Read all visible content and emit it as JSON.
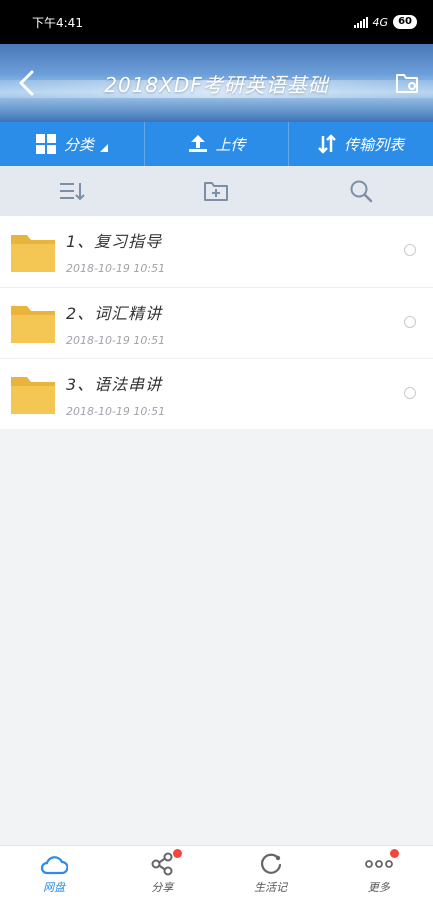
{
  "status_bar": {
    "time": "下午4:41",
    "network": "4G",
    "battery": "60"
  },
  "header": {
    "title": "2018XDF考研英语基础",
    "back_icon": "chevron-left-icon",
    "settings_icon": "folder-settings-icon"
  },
  "actions": {
    "category_label": "分类",
    "upload_label": "上传",
    "transfer_label": "传输列表"
  },
  "toolbar": {
    "sort_icon": "sort-icon",
    "new_folder_icon": "new-folder-icon",
    "search_icon": "search-icon"
  },
  "files": [
    {
      "name": "1、复习指导",
      "date": "2018-10-19  10:51"
    },
    {
      "name": "2、词汇精讲",
      "date": "2018-10-19  10:51"
    },
    {
      "name": "3、语法串讲",
      "date": "2018-10-19  10:51"
    }
  ],
  "nav": {
    "items": [
      {
        "label": "网盘",
        "icon": "cloud-icon",
        "active": true,
        "badge": false
      },
      {
        "label": "分享",
        "icon": "share-icon",
        "active": false,
        "badge": true
      },
      {
        "label": "生活记",
        "icon": "refresh-icon",
        "active": false,
        "badge": false
      },
      {
        "label": "更多",
        "icon": "more-icon",
        "active": false,
        "badge": true
      }
    ]
  },
  "colors": {
    "accent": "#2b8de8",
    "folder": "#f2c34f",
    "badge": "#f2463f"
  }
}
